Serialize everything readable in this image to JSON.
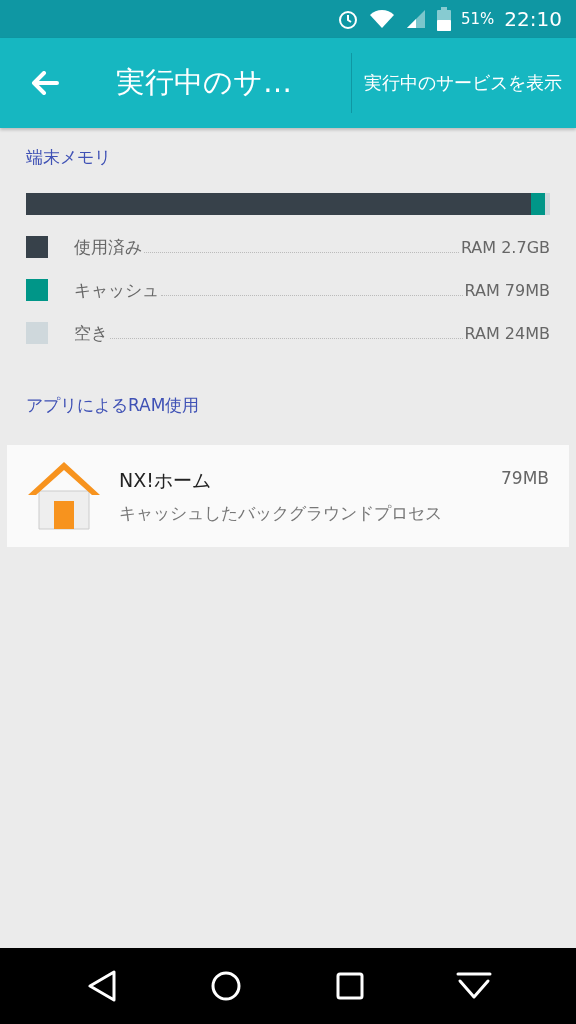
{
  "status_bar": {
    "battery": "51%",
    "time": "22:10"
  },
  "app_bar": {
    "title": "実行中のサ…",
    "action": "実行中のサービスを表示"
  },
  "memory": {
    "heading": "端末メモリ",
    "segments": [
      {
        "color": "#37414a",
        "level": 0.963
      },
      {
        "color": "#009688",
        "level": 0.027
      }
    ],
    "legend": [
      {
        "label": "使用済み",
        "value": "RAM 2.7GB",
        "color": "#37414a"
      },
      {
        "label": "キャッシュ",
        "value": "RAM 79MB",
        "color": "#009688"
      },
      {
        "label": "空き",
        "value": "RAM 24MB",
        "color": "#cfd8dc"
      }
    ]
  },
  "apps": {
    "heading": "アプリによるRAM使用",
    "items": [
      {
        "name": "NX!ホーム",
        "size": "79MB",
        "description": "キャッシュしたバックグラウンドプロセス"
      }
    ]
  }
}
